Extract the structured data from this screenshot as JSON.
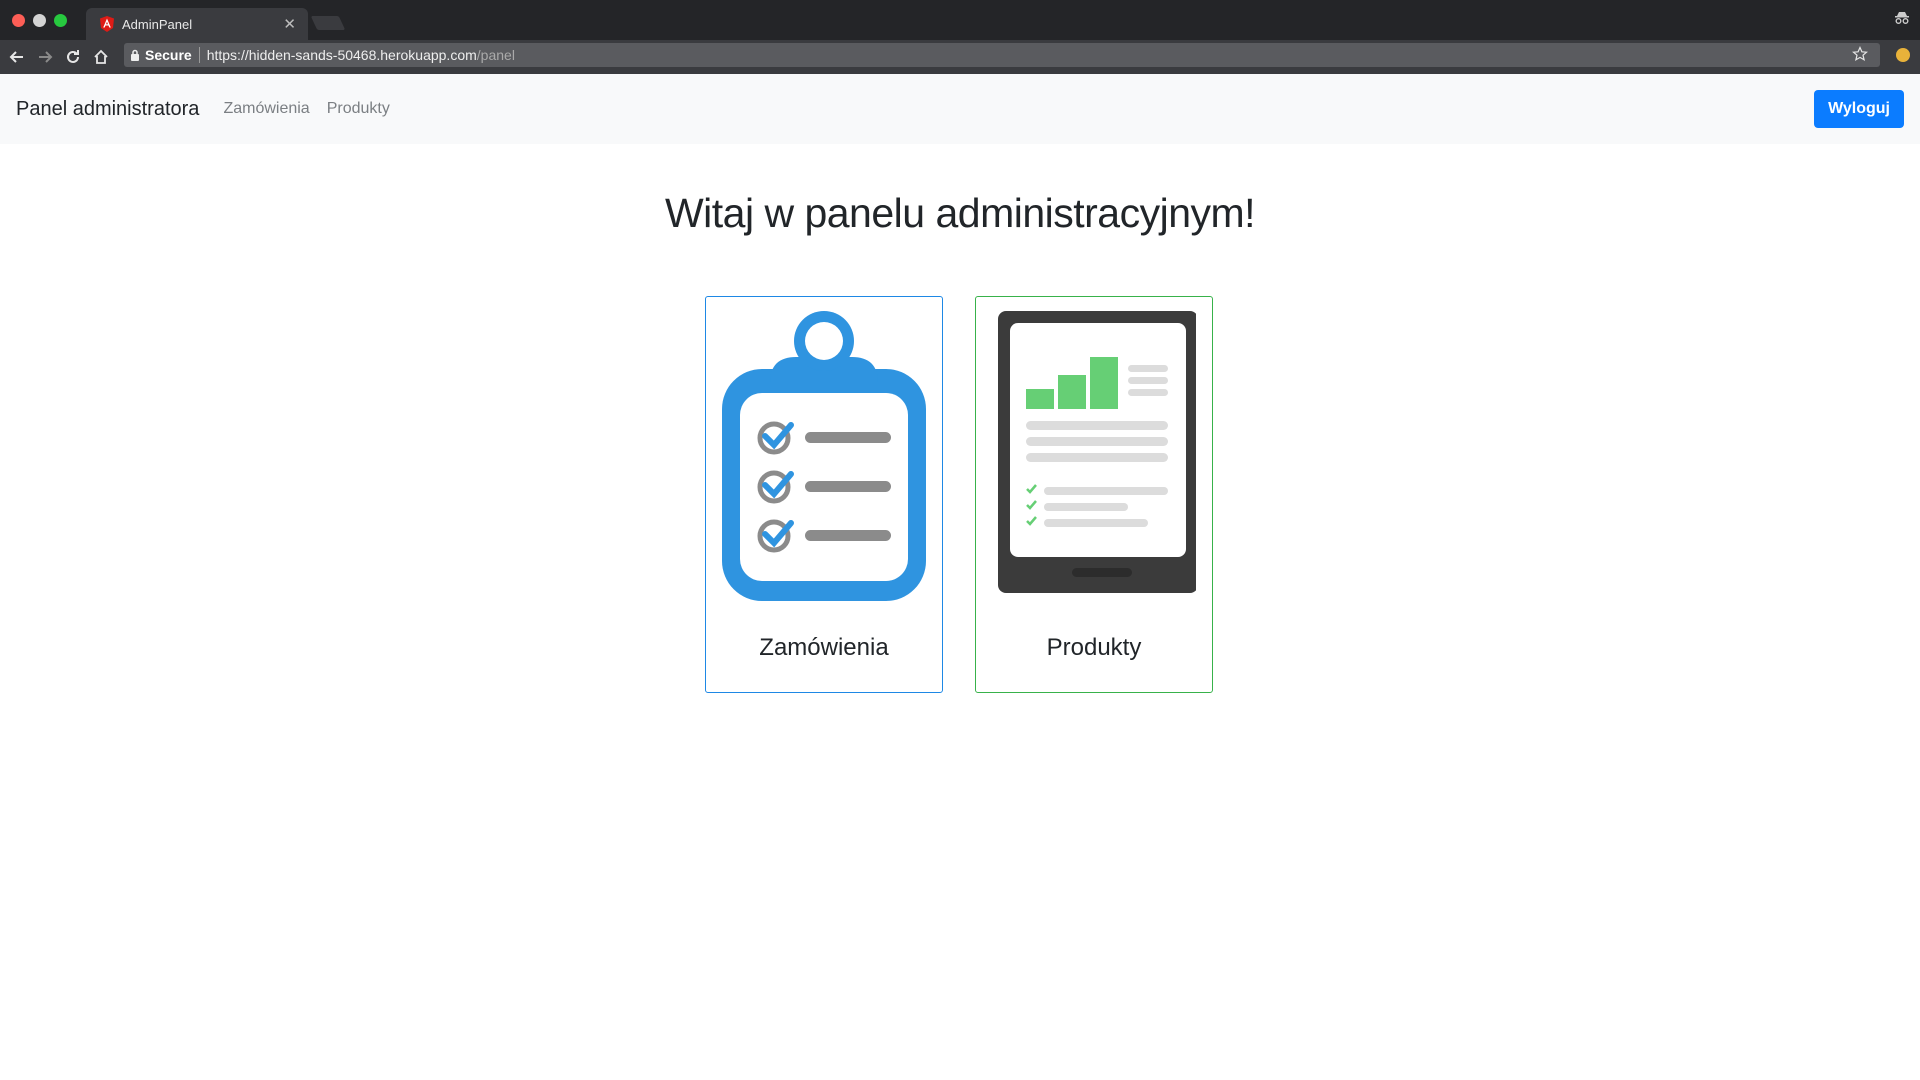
{
  "browser": {
    "tab_title": "AdminPanel",
    "secure_label": "Secure",
    "url_main": "https://hidden-sands-50468.herokuapp.com",
    "url_path": "/panel"
  },
  "navbar": {
    "brand": "Panel administratora",
    "links": [
      "Zamówienia",
      "Produkty"
    ],
    "logout_label": "Wyloguj"
  },
  "main": {
    "heading": "Witaj w panelu administracyjnym!",
    "cards": [
      {
        "title": "Zamówienia",
        "icon": "clipboard-checklist-icon",
        "border_color": "#1e88e5"
      },
      {
        "title": "Produkty",
        "icon": "tablet-report-icon",
        "border_color": "#38b24a"
      }
    ]
  },
  "colors": {
    "primary": "#0b7cff",
    "clipboard_blue": "#2f94e0",
    "chart_green": "#66cf75"
  }
}
